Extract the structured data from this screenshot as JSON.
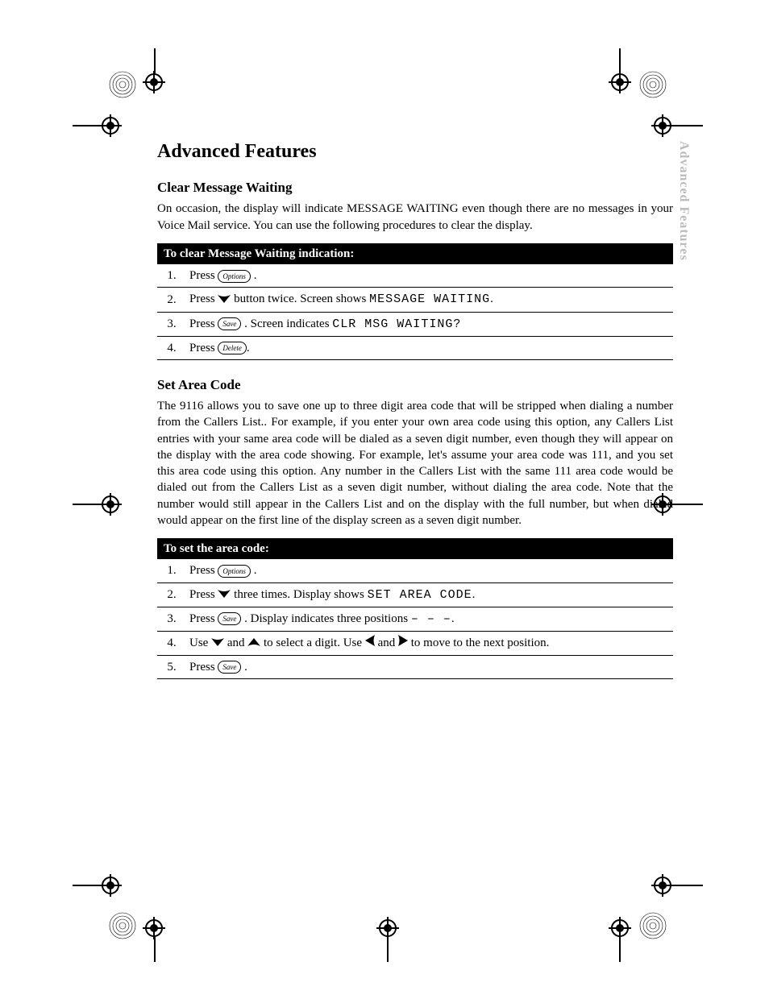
{
  "title": "Advanced Features",
  "thumb": "Advanced Features",
  "section1": {
    "heading": "Clear Message Waiting",
    "para": "On occasion, the display will indicate MESSAGE WAITING  even though there are no messages in your Voice Mail service.  You can use the following procedures to clear the display.",
    "banner": "To clear Message Waiting indication:",
    "steps": {
      "n1": "1.",
      "t1a": "Press ",
      "t1b": " .",
      "n2": "2.",
      "t2a": "Press ",
      "t2b": " button twice.  Screen shows ",
      "t2c": "MESSAGE WAITING",
      "t2d": ".",
      "n3": "3.",
      "t3a": "Press ",
      "t3b": " .  Screen indicates ",
      "t3c": "CLR MSG WAITING?",
      "n4": "4.",
      "t4a": "Press ",
      "t4b": "."
    }
  },
  "section2": {
    "heading": "Set Area Code",
    "para": "The 9116 allows you to save one up to three digit area code that will be stripped when dialing a number from the Callers List..  For example, if you enter your own area code using this option, any Callers List entries with your same area code will be dialed as a seven digit number, even though they will appear on the display with the area code showing.  For example, let's assume  your area code was 111, and you set this area code using this option.  Any number in the Callers List with the same 111 area code would be dialed out from the Callers List as a seven digit number, without dialing the area code.  Note that the number would still appear in the Callers List and on the display with the full number, but when dialed would appear on the first line of the display screen as a seven digit number.",
    "banner": "To set the area code:",
    "steps": {
      "n1": "1.",
      "t1a": "Press ",
      "t1b": " .",
      "n2": "2.",
      "t2a": "Press ",
      "t2b": " three times.  Display shows ",
      "t2c": "SET AREA CODE",
      "t2d": ".",
      "n3": "3.",
      "t3a": "Press ",
      "t3b": " .  Display indicates three positions ",
      "t3c": "– – –",
      "t3d": ".",
      "n4": "4.",
      "t4a": "Use ",
      "t4b": " and ",
      "t4c": " to select a digit.  Use ",
      "t4d": " and ",
      "t4e": " to move to the next position.",
      "n5": "5.",
      "t5a": "Press ",
      "t5b": " ."
    }
  },
  "keys": {
    "options": "Options",
    "save": "Save",
    "delete": "Delete"
  }
}
